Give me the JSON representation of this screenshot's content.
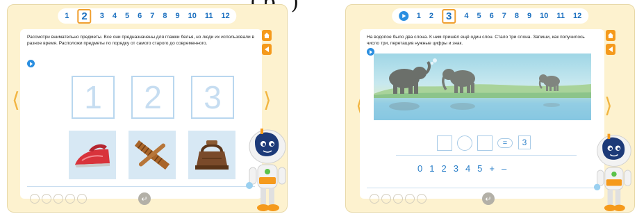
{
  "top_glyphs": "(р )",
  "screen1": {
    "pages": [
      "1",
      "2",
      "3",
      "4",
      "5",
      "6",
      "7",
      "8",
      "9",
      "10",
      "11",
      "12"
    ],
    "active_page": "2",
    "instruction": "Рассмотри внимательно предметы. Все они предназначены для глажки белья, но люди их использовали в разное время. Расположи предметы по порядку от самого старого до современного.",
    "slots": [
      "1",
      "2",
      "3"
    ],
    "items": [
      "iron-modern-icon",
      "wooden-press-icon",
      "iron-antique-icon"
    ],
    "nav_prev": "⟨",
    "nav_next": "⟩",
    "enter_symbol": "↵"
  },
  "screen2": {
    "pages": [
      "1",
      "2",
      "3",
      "4",
      "5",
      "6",
      "7",
      "8",
      "9",
      "10",
      "11",
      "12"
    ],
    "active_page": "3",
    "instruction": "На водопое было два слона. К ним пришёл ещё один слон. Стало три слона. Запиши, как получилось число три, перетащив нужные цифры и знак.",
    "equals": "=",
    "answer": "3",
    "digits": [
      "0",
      "1",
      "2",
      "3",
      "4",
      "5",
      "+",
      "–"
    ],
    "nav_prev": "⟨",
    "nav_next": "⟩",
    "enter_symbol": "↵"
  },
  "colors": {
    "background": "#fdf2cf",
    "accent": "#f59a1c",
    "blue": "#2a7fc9"
  }
}
